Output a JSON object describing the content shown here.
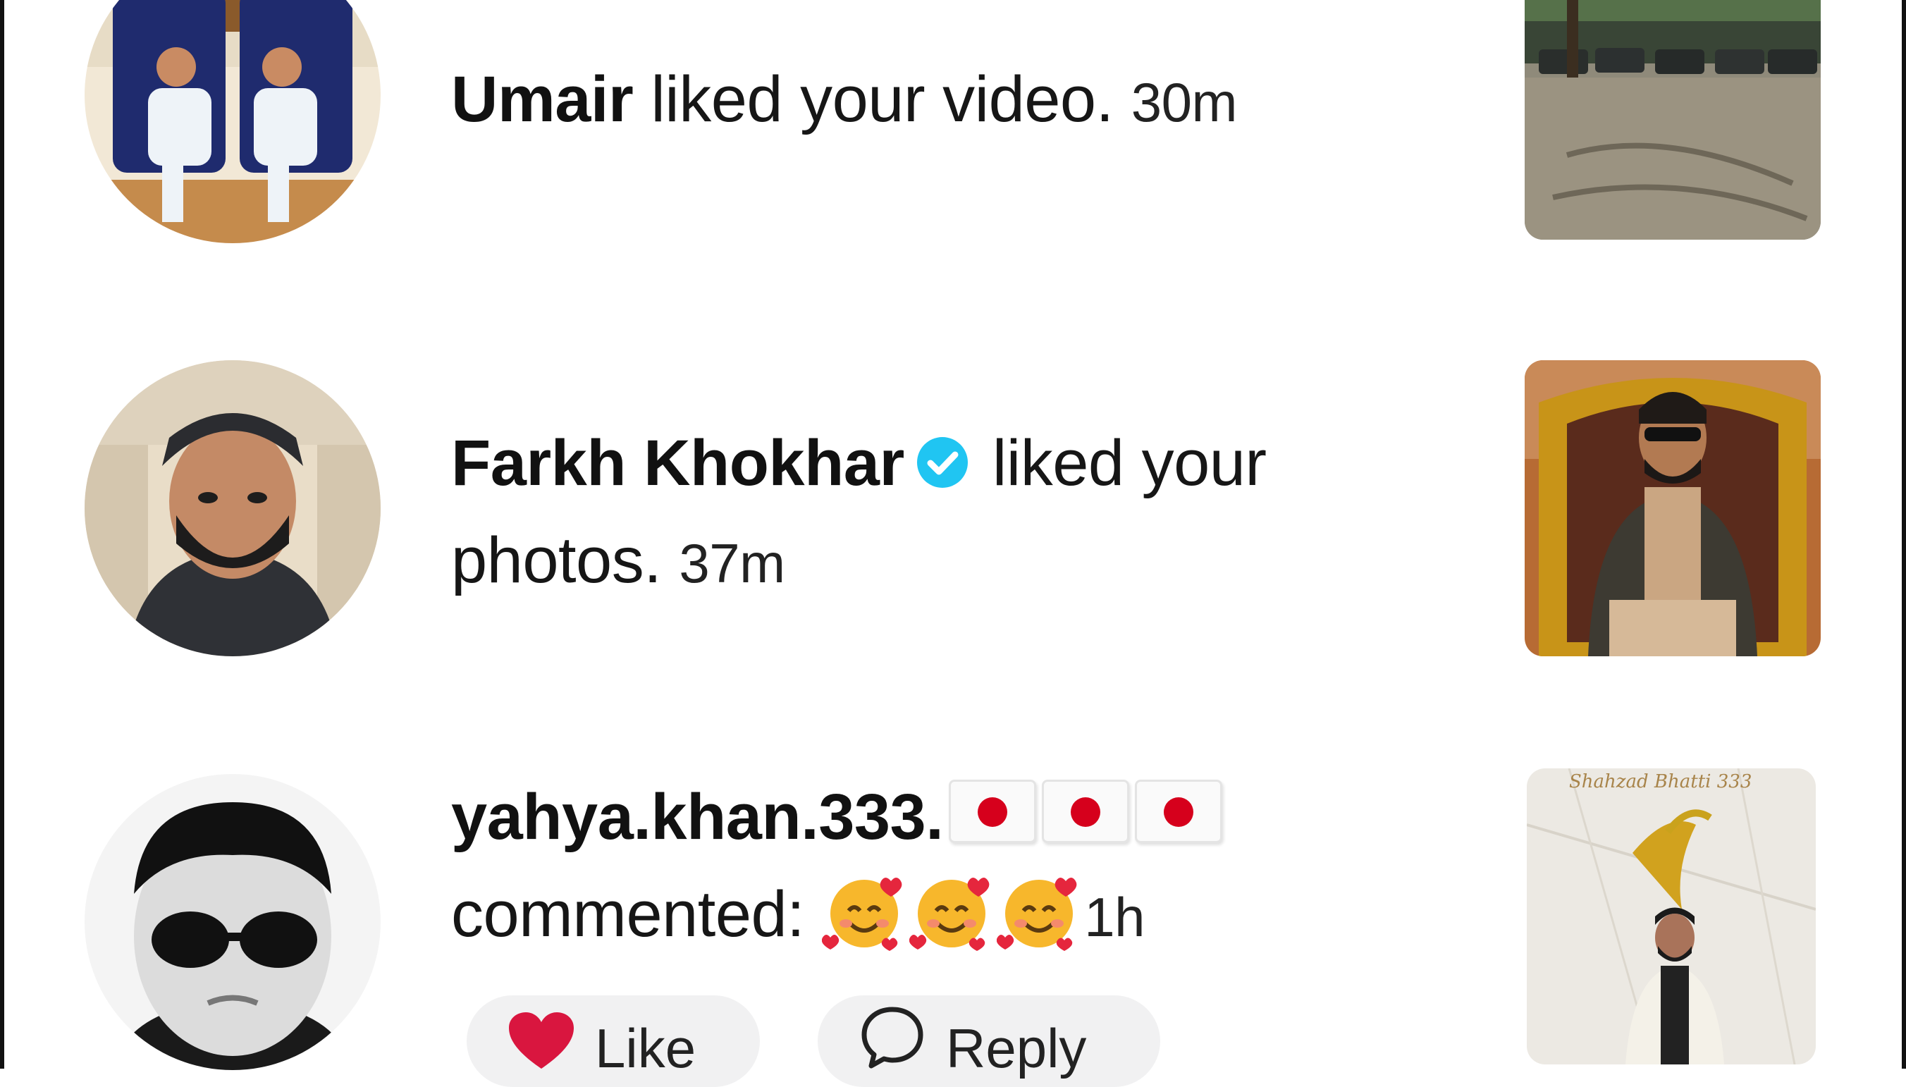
{
  "notifications": [
    {
      "username": "Umair",
      "action": " liked your video. ",
      "time": "30m",
      "avatar_icon": "avatar-photo",
      "thumb_icon": "video-thumbnail"
    },
    {
      "username": "Farkh Khokhar",
      "verified": true,
      "action_part1": " liked your",
      "action_part2": "photos. ",
      "time": "37m",
      "avatar_icon": "avatar-photo",
      "thumb_icon": "photo-thumbnail"
    },
    {
      "username": "yahya.khan.333.",
      "flags": [
        "japan-flag",
        "japan-flag",
        "japan-flag"
      ],
      "action": "commented: ",
      "emojis": [
        "smiling-face-with-hearts",
        "smiling-face-with-hearts",
        "smiling-face-with-hearts"
      ],
      "time": "1h",
      "actions": {
        "like_label": "Like",
        "reply_label": "Reply"
      },
      "thumb_caption": "Shahzad Bhatti 333",
      "avatar_icon": "avatar-photo",
      "thumb_icon": "video-thumbnail"
    }
  ],
  "colors": {
    "verified": "#20c5f2",
    "like_heart": "#d9163f",
    "pill_bg": "#f1f1f2"
  }
}
